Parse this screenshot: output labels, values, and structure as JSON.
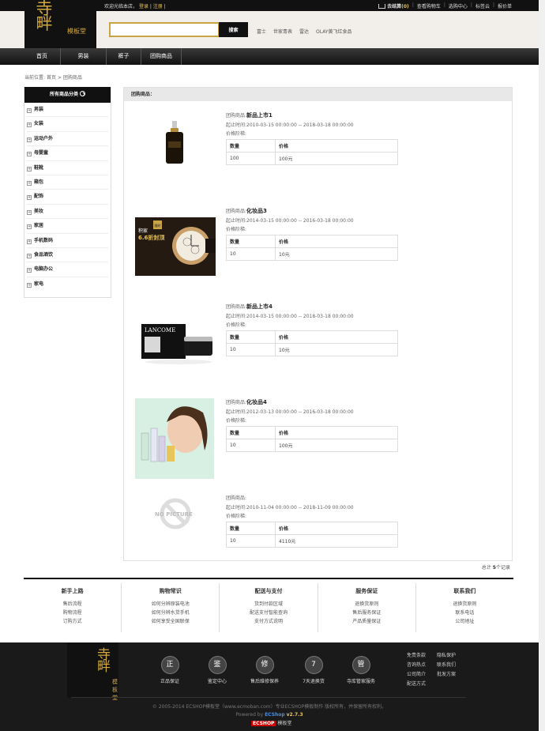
{
  "topbar": {
    "welcome": "欢迎光临本店，",
    "login": "登录",
    "register": "注册",
    "cart": "去结算",
    "cart_count": "(0)",
    "links": [
      "查看购物车",
      "选购中心",
      "标签云",
      "报价单"
    ]
  },
  "header": {
    "logo_char": "寺畔",
    "logo_text": "模板堂",
    "search_placeholder": "",
    "search_button": "搜索",
    "hot_keywords": [
      "富士",
      "世家青表",
      "雷达",
      "OLAY黄飞红食品"
    ]
  },
  "nav": [
    "首页",
    "男装",
    "裤子",
    "团购商品"
  ],
  "breadcrumb": {
    "label": "当前位置:",
    "home": "首页",
    "current": "团购商品"
  },
  "sidebar": {
    "title": "所有商品分类",
    "categories": [
      "男装",
      "女装",
      "运动户外",
      "母婴童",
      "鞋靴",
      "箱包",
      "配饰",
      "美妆",
      "家居",
      "手机数码",
      "食品酒饮",
      "电脑办公",
      "家电"
    ]
  },
  "main": {
    "title": "团购商品：",
    "labels": {
      "group": "团购商品:",
      "deadline": "起止时间:",
      "tiers": "价格阶梯:",
      "qty": "数量",
      "price": "价格"
    },
    "products": [
      {
        "name": "新品上市1",
        "time": "2010-03-15 00:00:00 -- 2018-03-18 00:00:00",
        "qty": "100",
        "price": "100元"
      },
      {
        "name": "化妆品3",
        "time": "2014-03-15 00:00:00 -- 2016-03-18 00:00:00",
        "qty": "10",
        "price": "10元",
        "banner": {
          "line1": "积家",
          "line2": "6.6折封顶",
          "badge": "限时"
        }
      },
      {
        "name": "新品上市4",
        "time": "2014-03-15 00:00:00 -- 2018-03-18 00:00:00",
        "qty": "10",
        "price": "10元",
        "brand": "LANCOME"
      },
      {
        "name": "化妆品4",
        "time": "2012-03-13 00:00:00 -- 2016-03-18 00:00:00",
        "qty": "10",
        "price": "100元"
      },
      {
        "name": "",
        "time": "2010-11-04 00:00:00 -- 2018-11-09 00:00:00",
        "qty": "10",
        "price": "4110元",
        "no_picture": "NO PICTURE"
      }
    ],
    "total_label": "总计",
    "total_count": "5",
    "total_unit": "个记录"
  },
  "footer_cols": [
    {
      "title": "新手上路",
      "links": [
        "售后流程",
        "购物流程",
        "订购方式"
      ]
    },
    {
      "title": "购物常识",
      "links": [
        "如何分辨原装电池",
        "如何分辨水货手机",
        "如何享受全国联保"
      ]
    },
    {
      "title": "配送与支付",
      "links": [
        "货到付款区域",
        "配送支付智能查询",
        "支付方式说明"
      ]
    },
    {
      "title": "服务保证",
      "links": [
        "退换货原则",
        "售后服务保证",
        "产品质量保证"
      ]
    },
    {
      "title": "联系我们",
      "links": [
        "退换货原则",
        "联系电话",
        "公司地址"
      ]
    }
  ],
  "bottom": {
    "logo_char": "寺畔",
    "logo_text": "模板堂",
    "services": [
      {
        "icon": "正",
        "label": "正品保证"
      },
      {
        "icon": "鉴",
        "label": "鉴定中心"
      },
      {
        "icon": "修",
        "label": "售后维修保养"
      },
      {
        "icon": "7",
        "label": "7天退换货"
      },
      {
        "icon": "管",
        "label": "寺库管家服务"
      }
    ],
    "links": [
      "免责条款",
      "隐私保护",
      "咨询热点",
      "联系我们",
      "公司简介",
      "批发方案",
      "配送方式"
    ],
    "copyright": "© 2005-2014 ECSHOP模板堂（www.ecmoban.com）专业ECSHOP模板制作 版权所有，并保留所有权利。",
    "powered_by": "Powered by",
    "ecshop": "ECShop",
    "version": "v2.7.3",
    "small_logo": "ECSHOP",
    "small_logo_text": "模板堂"
  }
}
